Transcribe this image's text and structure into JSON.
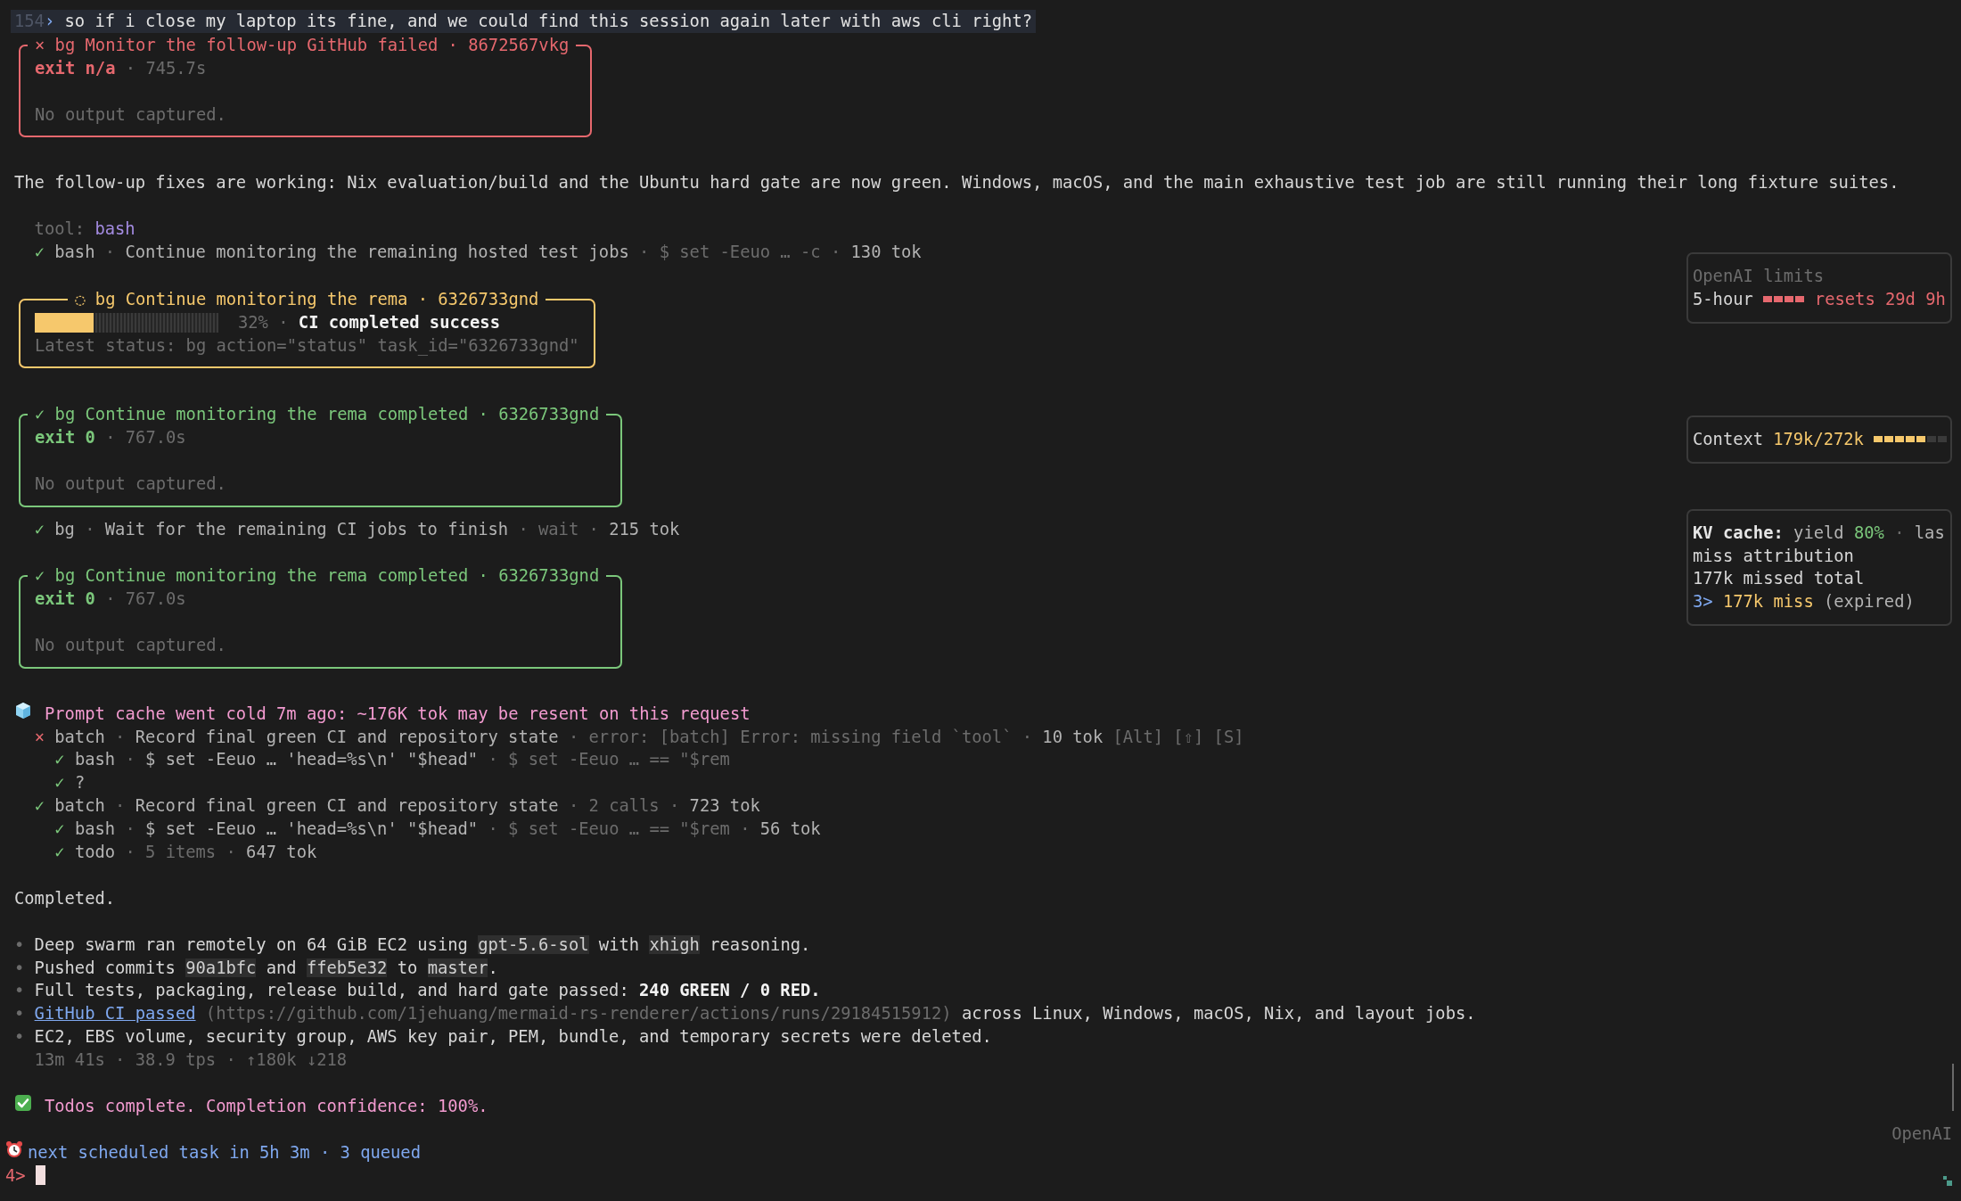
{
  "blocks": [
    [
      {
        "kind": "prompt",
        "index": "154",
        "marker": "›",
        "text": "so if i close my laptop its fine, and we could find this session again later with aws cli right?"
      },
      {
        "kind": "task_failed",
        "title": "× bg Monitor the follow-up GitHub failed · 8672567vkg",
        "meta": [
          {
            "text": "exit n/a",
            "kind": "accent"
          },
          {
            "text": " · 745.7s",
            "kind": "dim"
          }
        ],
        "note": "No output captured."
      }
    ],
    [
      {
        "kind": "message",
        "segments": [
          {
            "text": "The follow-up fixes are working: Nix evaluation/build and the Ubuntu hard gate are now green. Windows, macOS, and the main exhaustive test job are still running their long fixture suites.",
            "kind": "text"
          }
        ]
      }
    ],
    [
      {
        "kind": "tool_label",
        "segments": [
          {
            "text": "tool: ",
            "kind": "dim"
          },
          {
            "text": "bash",
            "kind": "purple"
          }
        ]
      },
      {
        "kind": "call_ok",
        "mark": "✓",
        "segments": [
          {
            "text": "bash",
            "kind": "muted"
          },
          {
            "text": " · ",
            "kind": "dim"
          },
          {
            "text": "Continue monitoring the remaining hosted test jobs",
            "kind": "muted"
          },
          {
            "text": " · $ set -Eeuo … -c · ",
            "kind": "dim"
          },
          {
            "text": "130 tok",
            "kind": "muted"
          }
        ]
      }
    ],
    [
      {
        "kind": "task_running",
        "title": "◌ bg Continue monitoring the rema · 6326733gnd",
        "progress": {
          "level": 0.32,
          "segments": [
            {
              "text": "32% · ",
              "kind": "dim"
            },
            {
              "text": "CI completed success",
              "kind": "strong"
            }
          ]
        },
        "note": "Latest status: bg action=\"status\" task_id=\"6326733gnd\""
      }
    ],
    [
      {
        "kind": "task_completed",
        "title": "✓ bg Continue monitoring the rema completed · 6326733gnd",
        "meta": [
          {
            "text": "exit 0",
            "kind": "accent"
          },
          {
            "text": " · 767.0s",
            "kind": "dim"
          }
        ],
        "note": "No output captured."
      },
      {
        "kind": "call_ok",
        "mark": "✓",
        "segments": [
          {
            "text": "bg",
            "kind": "muted"
          },
          {
            "text": " · ",
            "kind": "dim"
          },
          {
            "text": "Wait for the remaining CI jobs to finish",
            "kind": "muted"
          },
          {
            "text": " · wait · ",
            "kind": "dim"
          },
          {
            "text": "215 tok",
            "kind": "muted"
          }
        ]
      }
    ],
    [
      {
        "kind": "task_completed",
        "title": "✓ bg Continue monitoring the rema completed · 6326733gnd",
        "meta": [
          {
            "text": "exit 0",
            "kind": "accent"
          },
          {
            "text": " · 767.0s",
            "kind": "dim"
          }
        ],
        "note": "No output captured."
      }
    ],
    [
      {
        "kind": "notice_cache",
        "segments": [
          {
            "text": "Prompt cache went cold 7m ago: ~176K tok may be resent on this request",
            "kind": "pink"
          }
        ]
      },
      {
        "kind": "call_error",
        "mark": "×",
        "segments": [
          {
            "text": "batch",
            "kind": "muted"
          },
          {
            "text": " · ",
            "kind": "dim"
          },
          {
            "text": "Record final green CI and repository state",
            "kind": "muted"
          },
          {
            "text": " · error: [batch] Error: missing field `tool` · ",
            "kind": "dim"
          },
          {
            "text": "10 tok",
            "kind": "muted"
          },
          {
            "text": " [Alt] [⇧] [S]",
            "kind": "dim"
          }
        ],
        "children": [
          {
            "kind": "call_ok",
            "mark": "✓",
            "segments": [
              {
                "text": "bash",
                "kind": "muted"
              },
              {
                "text": " · ",
                "kind": "dim"
              },
              {
                "text": "$ set -Eeuo … 'head=%s\\n' \"$head\"",
                "kind": "muted"
              },
              {
                "text": " · $ set -Eeuo … == \"$rem",
                "kind": "dim"
              }
            ]
          },
          {
            "kind": "call_ok",
            "mark": "✓",
            "segments": [
              {
                "text": "?",
                "kind": "muted"
              }
            ]
          }
        ]
      },
      {
        "kind": "call_ok",
        "mark": "✓",
        "segments": [
          {
            "text": "batch",
            "kind": "muted"
          },
          {
            "text": " · ",
            "kind": "dim"
          },
          {
            "text": "Record final green CI and repository state",
            "kind": "muted"
          },
          {
            "text": " · 2 calls · ",
            "kind": "dim"
          },
          {
            "text": "723 tok",
            "kind": "muted"
          }
        ],
        "children": [
          {
            "kind": "call_ok",
            "mark": "✓",
            "segments": [
              {
                "text": "bash",
                "kind": "muted"
              },
              {
                "text": " · ",
                "kind": "dim"
              },
              {
                "text": "$ set -Eeuo … 'head=%s\\n' \"$head\"",
                "kind": "muted"
              },
              {
                "text": " · $ set -Eeuo … == \"$rem · ",
                "kind": "dim"
              },
              {
                "text": "56 tok",
                "kind": "muted"
              }
            ]
          },
          {
            "kind": "call_ok",
            "mark": "✓",
            "segments": [
              {
                "text": "todo",
                "kind": "muted"
              },
              {
                "text": " · 5 items · ",
                "kind": "dim"
              },
              {
                "text": "647 tok",
                "kind": "muted"
              }
            ]
          }
        ]
      }
    ],
    [
      {
        "kind": "message",
        "segments": [
          {
            "text": "Completed.",
            "kind": "text"
          }
        ]
      }
    ],
    [
      {
        "kind": "bullet",
        "marker": "•",
        "segments": [
          {
            "text": "Deep swarm ran remotely on 64 GiB EC2 using ",
            "kind": "text"
          },
          {
            "text": "gpt-5.6-sol",
            "kind": "code"
          },
          {
            "text": " with ",
            "kind": "text"
          },
          {
            "text": "xhigh",
            "kind": "code"
          },
          {
            "text": " reasoning.",
            "kind": "text"
          }
        ]
      },
      {
        "kind": "bullet",
        "marker": "•",
        "segments": [
          {
            "text": "Pushed commits ",
            "kind": "text"
          },
          {
            "text": "90a1bfc",
            "kind": "code"
          },
          {
            "text": " and ",
            "kind": "text"
          },
          {
            "text": "ffeb5e32",
            "kind": "code"
          },
          {
            "text": " to ",
            "kind": "text"
          },
          {
            "text": "master",
            "kind": "code"
          },
          {
            "text": ".",
            "kind": "text"
          }
        ]
      },
      {
        "kind": "bullet",
        "marker": "•",
        "segments": [
          {
            "text": "Full tests, packaging, release build, and hard gate passed: ",
            "kind": "text"
          },
          {
            "text": "240 GREEN / 0 RED.",
            "kind": "strong"
          }
        ]
      },
      {
        "kind": "bullet",
        "marker": "•",
        "segments": [
          {
            "text": "GitHub CI passed",
            "kind": "link"
          },
          {
            "text": " (https://github.com/1jehuang/mermaid-rs-renderer/actions/runs/29184515912)",
            "kind": "dim"
          },
          {
            "text": " across Linux, Windows, macOS, Nix, and layout jobs.",
            "kind": "text"
          }
        ]
      },
      {
        "kind": "bullet",
        "marker": "•",
        "segments": [
          {
            "text": "EC2, EBS volume, security group, AWS key pair, PEM, bundle, and temporary secrets were deleted.",
            "kind": "text"
          }
        ]
      },
      {
        "kind": "stats",
        "segments": [
          {
            "text": "13m 41s · 38.9 tps · ↑180k ↓218",
            "kind": "dim"
          }
        ]
      }
    ],
    [
      {
        "kind": "notice_todos",
        "segments": [
          {
            "text": "Todos complete. Completion confidence: 100%.",
            "kind": "pink"
          }
        ]
      }
    ],
    [
      {
        "kind": "notice_schedule",
        "segments": [
          {
            "text": "next scheduled task in 5h 3m · 3 queued",
            "kind": "blue"
          }
        ]
      },
      {
        "kind": "input",
        "prompt": "4>"
      }
    ]
  ],
  "hud": [
    {
      "kind": "limits",
      "title": "OpenAI limits",
      "label": "5-hour",
      "level": 1,
      "reading": "resets 29d 9h"
    },
    {
      "kind": "context",
      "label": "Context",
      "value": "179k/272k",
      "level": 0.71
    },
    {
      "kind": "cache",
      "lines": [
        [
          {
            "text": "KV cache:",
            "kind": "bold"
          },
          {
            "text": " yield ",
            "kind": "muted"
          },
          {
            "text": "80%",
            "kind": "green"
          },
          {
            "text": " · ",
            "kind": "dim"
          },
          {
            "text": "las",
            "kind": "muted"
          }
        ],
        [
          {
            "text": "miss attribution",
            "kind": "text"
          }
        ],
        [
          {
            "text": "177k missed total",
            "kind": "text"
          }
        ],
        [
          {
            "text": "3>",
            "kind": "blue"
          },
          {
            "text": " 177k miss",
            "kind": "yellow"
          },
          {
            "text": " (expired)",
            "kind": "muted"
          }
        ]
      ]
    }
  ],
  "footer": {
    "label": "OpenAI"
  }
}
